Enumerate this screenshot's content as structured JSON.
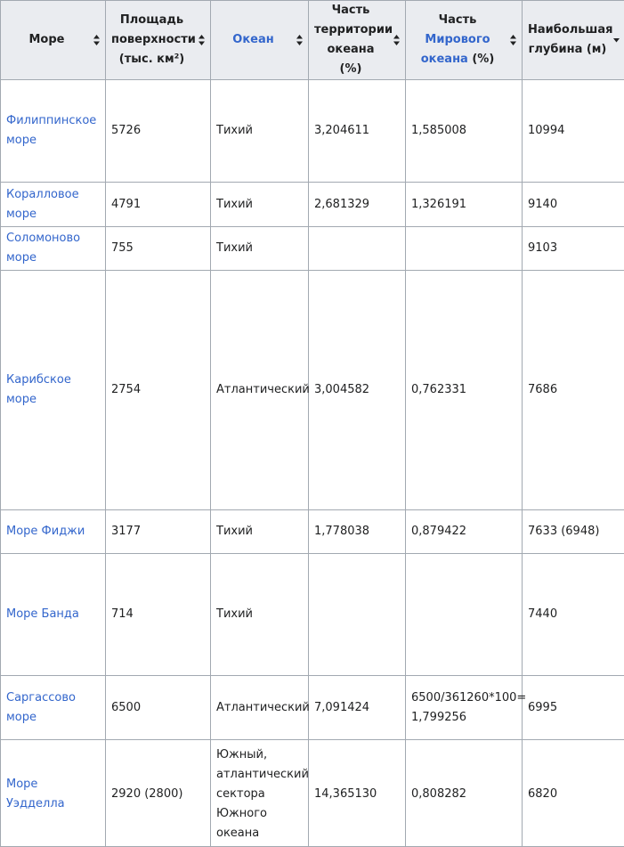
{
  "headers": {
    "sea": "Море",
    "area_line1": "Площадь",
    "area_line2": "поверхности",
    "area_line3": "(тыс. км²)",
    "ocean": "Океан",
    "part_terr_line1": "Часть",
    "part_terr_line2": "территории",
    "part_terr_line3": "океана (%)",
    "part_world_line1": "Часть",
    "part_world_link1": "Мирового",
    "part_world_link2": "океана",
    "part_world_suffix": " (%)",
    "depth_line1": "Наибольшая",
    "depth_line2": "глубина (м)"
  },
  "sort_icons": {
    "sea": "sort-both-icon",
    "area": "sort-both-icon",
    "ocean": "sort-both-icon",
    "part_terr": "sort-both-icon",
    "part_world": "sort-both-icon",
    "depth": "sort-descending-icon"
  },
  "rows": [
    {
      "name_line1": "Филиппинское",
      "name_line2": "море",
      "area": "5726",
      "ocean_lines": [
        "Тихий"
      ],
      "part_terr": "3,204611",
      "part_world_lines": [
        "1,585008"
      ],
      "depth": "10994"
    },
    {
      "name_line1": "Коралловое",
      "name_line2": "море",
      "area": "4791",
      "ocean_lines": [
        "Тихий"
      ],
      "part_terr": "2,681329",
      "part_world_lines": [
        "1,326191"
      ],
      "depth": "9140"
    },
    {
      "name_line1": "Соломоново",
      "name_line2": "море",
      "area": "755",
      "ocean_lines": [
        "Тихий"
      ],
      "part_terr": "",
      "part_world_lines": [
        ""
      ],
      "depth": "9103"
    },
    {
      "name_line1": "Карибское море",
      "name_line2": "",
      "area": "2754",
      "ocean_lines": [
        "Атлантический"
      ],
      "part_terr": "3,004582",
      "part_world_lines": [
        "0,762331"
      ],
      "depth": "7686"
    },
    {
      "name_line1": "Море Фиджи",
      "name_line2": "",
      "area": "3177",
      "ocean_lines": [
        "Тихий"
      ],
      "part_terr": "1,778038",
      "part_world_lines": [
        "0,879422"
      ],
      "depth": "7633 (6948)"
    },
    {
      "name_line1": "Море Банда",
      "name_line2": "",
      "area": "714",
      "ocean_lines": [
        "Тихий"
      ],
      "part_terr": "",
      "part_world_lines": [
        ""
      ],
      "depth": "7440"
    },
    {
      "name_line1": "Саргассово",
      "name_line2": "море",
      "area": "6500",
      "ocean_lines": [
        "Атлантический"
      ],
      "part_terr": "7,091424",
      "part_world_lines": [
        "6500/361260*100=",
        "1,799256"
      ],
      "depth": "6995"
    },
    {
      "name_line1": "Море Уэдделла",
      "name_line2": "",
      "area": "2920 (2800)",
      "ocean_lines": [
        "Южный,",
        "атлантический",
        "сектора",
        "Южного",
        "океана"
      ],
      "part_terr": "14,365130",
      "part_world_lines": [
        "0,808282"
      ],
      "depth": "6820"
    }
  ]
}
